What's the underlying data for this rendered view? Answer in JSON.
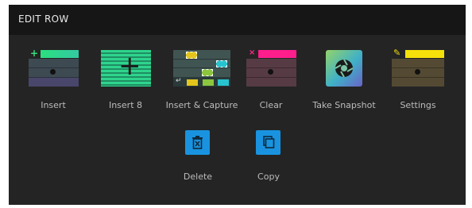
{
  "title": "EDIT ROW",
  "actions": [
    {
      "label": "Insert"
    },
    {
      "label": "Insert 8"
    },
    {
      "label": "Insert & Capture"
    },
    {
      "label": "Clear"
    },
    {
      "label": "Take Snapshot"
    },
    {
      "label": "Settings"
    }
  ],
  "buttons": [
    {
      "label": "Delete"
    },
    {
      "label": "Copy"
    }
  ],
  "colors": {
    "accent_blue": "#1993df",
    "insert_green": "#2fd58a",
    "clear_pink": "#ff1e8c",
    "settings_yellow": "#f6e10a"
  }
}
